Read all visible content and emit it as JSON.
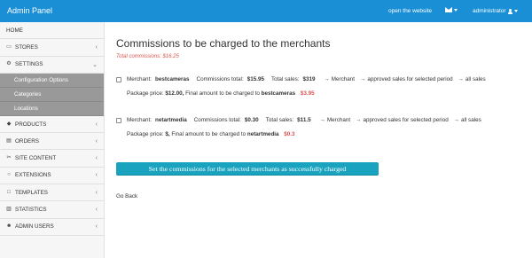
{
  "topbar": {
    "brand": "Admin Panel",
    "open_site": "open the website",
    "user": "administrator"
  },
  "sidebar": {
    "items": [
      {
        "label": "HOME",
        "icon": "",
        "chevron": false
      },
      {
        "label": "STORES",
        "icon": "monitor-icon",
        "chevron": true
      },
      {
        "label": "SETTINGS",
        "icon": "gears-icon",
        "chevron": true,
        "expanded": true
      },
      {
        "label": "PRODUCTS",
        "icon": "tag-icon",
        "chevron": true
      },
      {
        "label": "ORDERS",
        "icon": "orders-icon",
        "chevron": true
      },
      {
        "label": "SITE CONTENT",
        "icon": "scissors-icon",
        "chevron": true
      },
      {
        "label": "EXTENSIONS",
        "icon": "circle-icon",
        "chevron": true
      },
      {
        "label": "TEMPLATES",
        "icon": "square-icon",
        "chevron": true
      },
      {
        "label": "STATISTICS",
        "icon": "chart-icon",
        "chevron": true
      },
      {
        "label": "ADMIN USERS",
        "icon": "users-icon",
        "chevron": true
      }
    ],
    "sub_items": [
      "Configuration Options",
      "Categories",
      "Locations"
    ]
  },
  "main": {
    "title": "Commissions to be charged to the merchants",
    "total": "Total commissions: $16.25",
    "merchants": [
      {
        "merchant_label": "Merchant:",
        "merchant": "bestcameras",
        "commissions_label": "Commissions total:",
        "commissions": "$15.95",
        "sales_label": "Total sales:",
        "sales": "$319",
        "arrow1": "→",
        "merchant_link": "Merchant",
        "arrow2": "→",
        "approved": "approved sales for selected period",
        "arrow3": "→",
        "all_sales": "all sales",
        "package_label": "Package price:",
        "package": "$12.00,",
        "final_label": "Final amount to be charged to",
        "final_merchant": "bestcameras",
        "final_amount": "$3.95"
      },
      {
        "merchant_label": "Merchant:",
        "merchant": "netartmedia",
        "commissions_label": "Commissions total:",
        "commissions": "$0.30",
        "sales_label": "Total sales:",
        "sales": "$11.5",
        "arrow1": "→",
        "merchant_link": "Merchant",
        "arrow2": "→",
        "approved": "approved sales for selected period",
        "arrow3": "→",
        "all_sales": "all sales",
        "package_label": "Package price:",
        "package": "$,",
        "final_label": "Final amount to be charged to",
        "final_merchant": "netartmedia",
        "final_amount": "$0.3"
      }
    ],
    "button": "Set the commissions for the selected merchants as successfully charged",
    "go_back": "Go Back"
  },
  "colors": {
    "topbar": "#1a8fd6",
    "button": "#1aa3bf",
    "accent_red": "#d9534f",
    "sidebar_sub": "#999999"
  }
}
